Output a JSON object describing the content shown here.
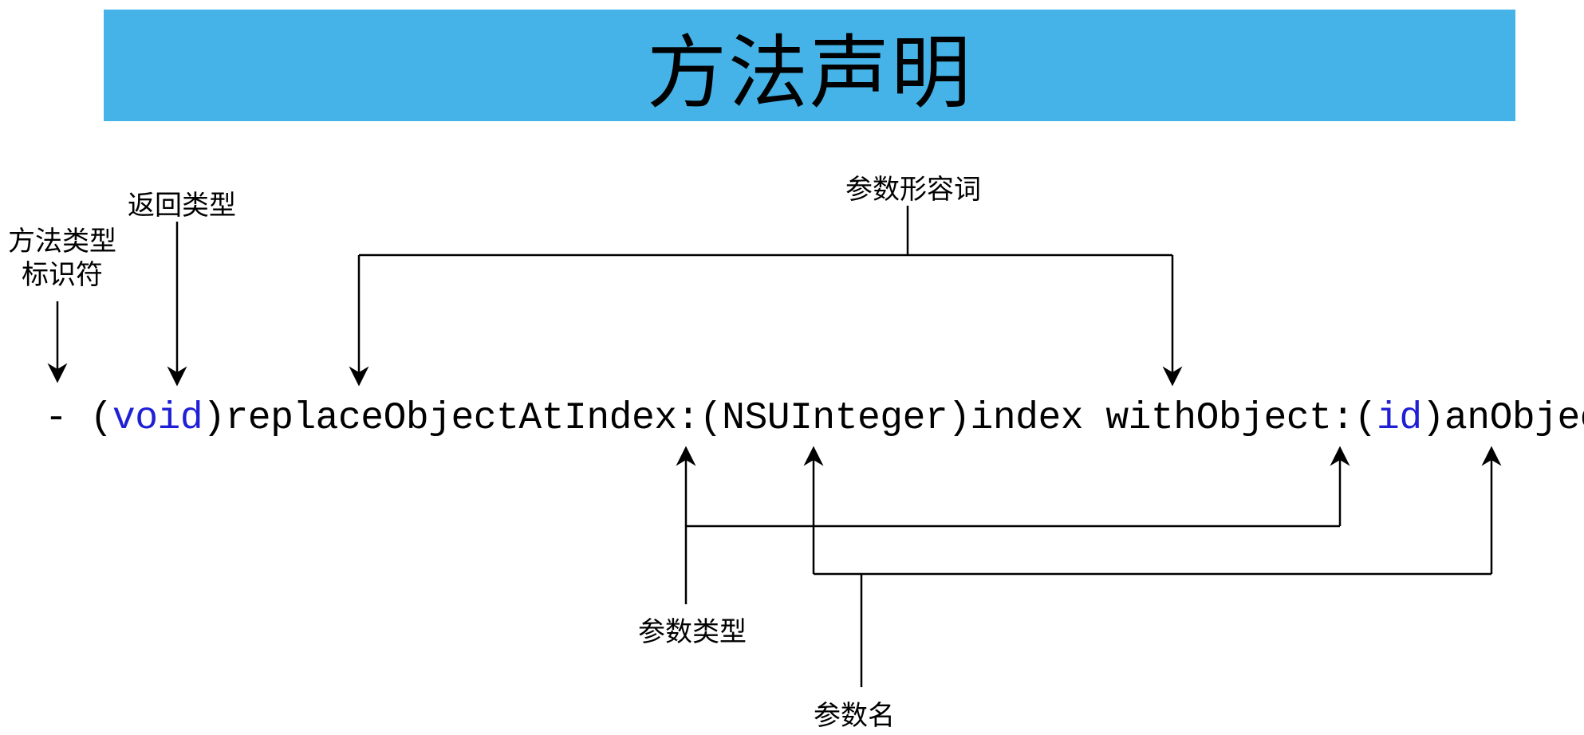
{
  "title": "方法声明",
  "labels": {
    "method_type_identifier": "方法类型\n标识符",
    "return_type": "返回类型",
    "param_adjective": "参数形容词",
    "param_type": "参数类型",
    "param_name": "参数名"
  },
  "code": {
    "minus": "- ",
    "open1": "(",
    "void": "void",
    "close1": ")",
    "method1": "replaceObjectAtIndex:",
    "open2": "(",
    "type1": "NSUInteger",
    "close2": ")",
    "param1": "index ",
    "method2": "withObject:",
    "open3": "(",
    "id": "id",
    "close3": ")",
    "param2": "anObject"
  }
}
